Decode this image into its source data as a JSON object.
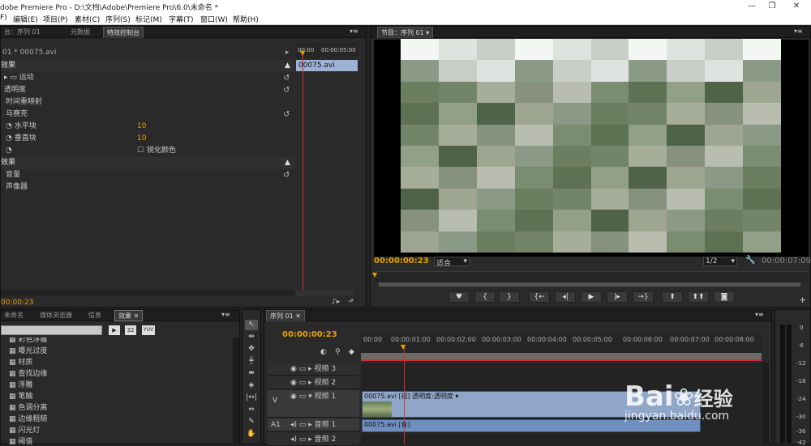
{
  "window": {
    "title": "dobe Premiere Pro - D:\\文档\\Adobe\\Premiere Pro\\6.0\\未命名 *",
    "minimize": "—",
    "restore": "❐",
    "close": "✕"
  },
  "menu": [
    "F)",
    "编辑(E)",
    "项目(P)",
    "素材(C)",
    "序列(S)",
    "标记(M)",
    "字幕(T)",
    "窗口(W)",
    "帮助(H)"
  ],
  "top_left_tabs": [
    "台：序列 01",
    "元数据",
    "特效控制台"
  ],
  "effect_controls": {
    "clip_label": "01 * 00075.avi",
    "time_start": "00:00",
    "time_end": "00:00:05:00",
    "clip_name": "00075.avi",
    "video_section": "效果",
    "motion": "运动",
    "opacity": "透明度",
    "time_remap": "时间重映射",
    "mosaic": "马赛克",
    "h_blocks_label": "水平块",
    "h_blocks_value": "10",
    "v_blocks_label": "垂直块",
    "v_blocks_value": "10",
    "sharpen": "锐化颜色",
    "audio_section": "效果",
    "volume": "音量",
    "panner": "声像器",
    "timecode": "00:00:23"
  },
  "program": {
    "tab": "节目：序列 01",
    "dropdown": "▾",
    "timecode": "00:00:00:23",
    "fit": "适合",
    "fraction": "1/2",
    "duration": "00:00:07:09"
  },
  "bottom_left_tabs": [
    "未命名",
    "媒体浏览器",
    "信息",
    "效果"
  ],
  "effects_list": [
    "彩色浮雕",
    "曝光过度",
    "材质",
    "查找边缘",
    "浮雕",
    "笔触",
    "色调分离",
    "边缘粗糙",
    "闪光灯",
    "阈值"
  ],
  "effects_icons": [
    "32",
    "YUV"
  ],
  "timeline": {
    "tab": "序列 01",
    "timecode": "00:00:00:23",
    "ticks": [
      "00:00",
      "00:00:01:00",
      "00:00:02:00",
      "00:00:03:00",
      "00:00:04:00",
      "00:00:05:00",
      "00:00:06:00",
      "00:00:07:00",
      "00:00:08:00"
    ],
    "v_label": "V",
    "a_label": "A1",
    "video3": "视频 3",
    "video2": "视频 2",
    "video1": "视频 1",
    "audio1": "音频 1",
    "audio2": "音频 2",
    "clip_video": "00075.avi [视] 透明度:透明度 ▾",
    "clip_audio": "00075.avi [音]"
  },
  "meter": [
    "0",
    "-6",
    "-12",
    "-18",
    "-24",
    "-30",
    "-36",
    "-42"
  ],
  "watermark": {
    "brand": "Bai",
    "brand2": "经验",
    "url": "jingyan.baidu.com"
  },
  "colors": {
    "accent_orange": "#e8a000",
    "playhead_red": "#d23030",
    "clip_blue": "#8fa6c8"
  }
}
